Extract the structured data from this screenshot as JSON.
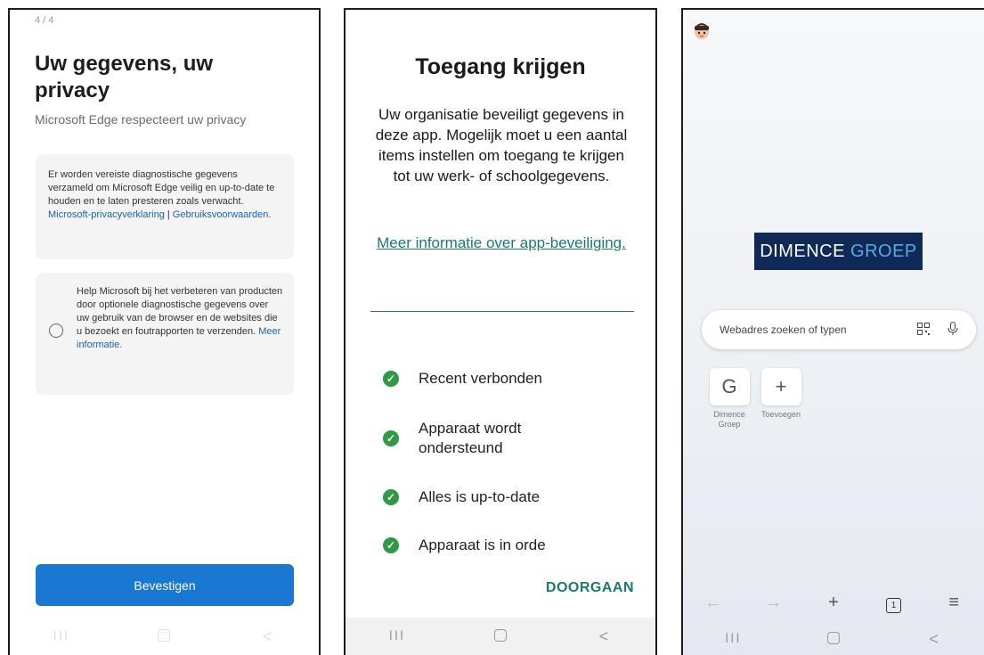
{
  "panel1": {
    "step_indicator": "4 / 4",
    "title": "Uw gegevens, uw privacy",
    "subtitle": "Microsoft Edge respecteert uw privacy",
    "card1_text": "Er worden vereiste diagnostische gegevens verzameld om Microsoft Edge veilig en up-to-date te houden en te laten presteren zoals verwacht.",
    "privacy_link": "Microsoft-privacyverklaring",
    "separator": "|",
    "terms_link": "Gebruiksvoorwaarden.",
    "card2_text": "Help Microsoft bij het verbeteren van producten door optionele diagnostische gegevens over uw gebruik van de browser en de websites die u bezoekt en foutrapporten te verzenden.",
    "more_info_link": "Meer informatie.",
    "optional_diagnostics_checked": false,
    "confirm_button": "Bevestigen"
  },
  "panel2": {
    "title": "Toegang krijgen",
    "description": "Uw organisatie beveiligt gegevens in deze app. Mogelijk moet u een aantal items instellen om toegang te krijgen tot uw werk- of schoolgegevens.",
    "more_info_link": "Meer informatie over app-beveiliging.",
    "checks": [
      {
        "label": "Recent verbonden"
      },
      {
        "label": "Apparaat wordt ondersteund"
      },
      {
        "label": "Alles is up-to-date"
      },
      {
        "label": "Apparaat is in orde"
      }
    ],
    "continue_button": "DOORGAAN"
  },
  "panel3": {
    "logo_text_1": "DIMENCE",
    "logo_text_2": "GROEP",
    "search_placeholder": "Webadres zoeken of typen",
    "tiles": [
      {
        "glyph": "G",
        "label": "Dimence Groep"
      },
      {
        "glyph": "+",
        "label": "Toevoegen"
      }
    ],
    "tab_count": "1"
  },
  "navbar": {
    "recent": "III",
    "back": "<"
  },
  "colors": {
    "edge_blue": "#1a78d2",
    "intune_teal": "#1a7a6e",
    "check_green": "#2e9a44",
    "logo_navy": "#0f2a56"
  }
}
